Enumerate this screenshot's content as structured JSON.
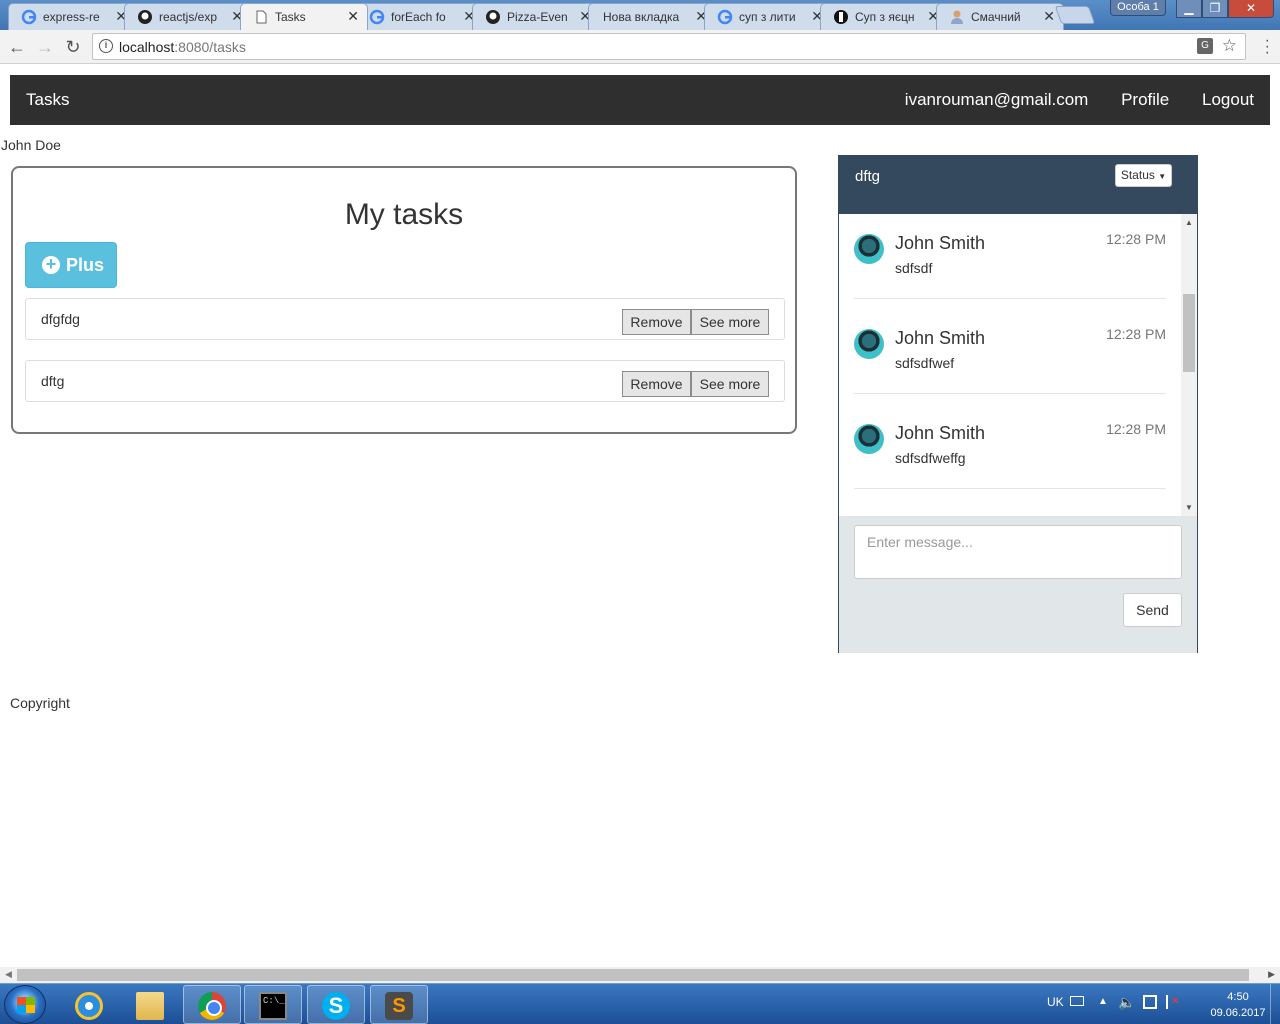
{
  "browser": {
    "tabs": [
      {
        "label": "express-re",
        "icon": "google-icon"
      },
      {
        "label": "reactjs/exp",
        "icon": "github-icon"
      },
      {
        "label": "Tasks",
        "icon": "page-icon"
      },
      {
        "label": "forEach fo",
        "icon": "google-icon"
      },
      {
        "label": "Pizza-Even",
        "icon": "github-icon"
      },
      {
        "label": "Нова вкладка",
        "icon": ""
      },
      {
        "label": "суп з лити",
        "icon": "google-icon"
      },
      {
        "label": "Суп з яєцн",
        "icon": "site-icon"
      },
      {
        "label": "Смачний",
        "icon": "profile-icon"
      }
    ],
    "profile": "Особа 1",
    "url_host": "localhost",
    "url_rest": ":8080/tasks"
  },
  "navbar": {
    "brand": "Tasks",
    "email": "ivanrouman@gmail.com",
    "profile": "Profile",
    "logout": "Logout"
  },
  "user": {
    "name": "John Doe"
  },
  "tasks": {
    "title": "My tasks",
    "plus_label": "Plus",
    "remove_label": "Remove",
    "see_more_label": "See more",
    "items": [
      {
        "name": "dfgfdg"
      },
      {
        "name": "dftg"
      }
    ]
  },
  "chat": {
    "title": "dftg",
    "status_label": "Status",
    "messages": [
      {
        "author": "John Smith",
        "time": "12:28 PM",
        "text": "sdfsdf"
      },
      {
        "author": "John Smith",
        "time": "12:28 PM",
        "text": "sdfsdfwef"
      },
      {
        "author": "John Smith",
        "time": "12:28 PM",
        "text": "sdfsdfweffg"
      }
    ],
    "input_placeholder": "Enter message...",
    "send_label": "Send"
  },
  "footer": {
    "copyright": "Copyright"
  },
  "taskbar": {
    "language": "UK",
    "time": "4:50",
    "date": "09.06.2017"
  }
}
